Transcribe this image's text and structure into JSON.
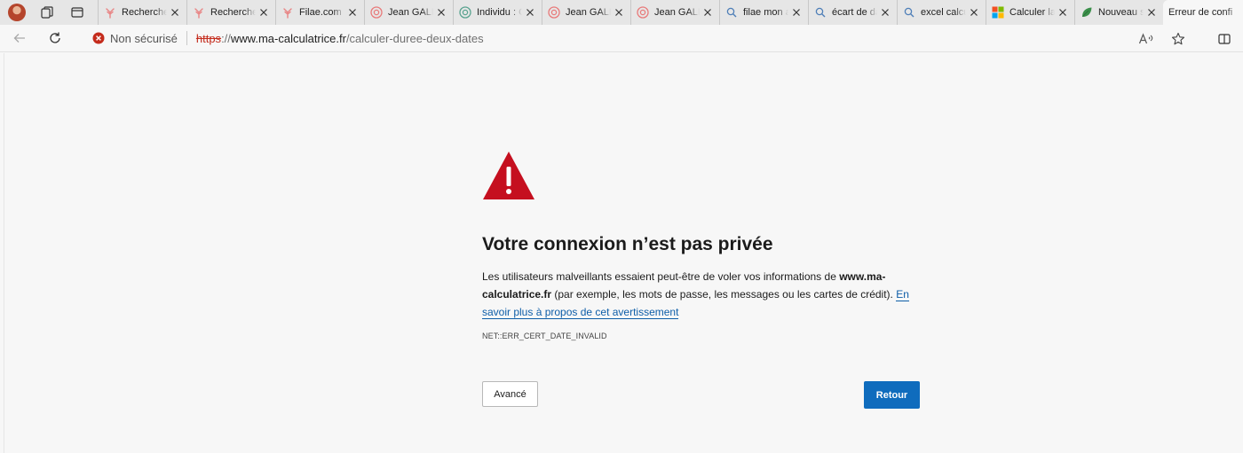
{
  "tabs": [
    {
      "title": "Recherche",
      "icon": "filae-tree-icon"
    },
    {
      "title": "Recherche",
      "icon": "filae-tree-icon"
    },
    {
      "title": "Filae.com -",
      "icon": "filae-tree-icon"
    },
    {
      "title": "Jean GALLE",
      "icon": "geneanet-icon"
    },
    {
      "title": "Individu : G",
      "icon": "geneanet-green-icon"
    },
    {
      "title": "Jean GALLE",
      "icon": "geneanet-icon"
    },
    {
      "title": "Jean GALLE",
      "icon": "geneanet-icon"
    },
    {
      "title": "filae mon a",
      "icon": "search-icon"
    },
    {
      "title": "écart de da",
      "icon": "search-icon"
    },
    {
      "title": "excel calcul",
      "icon": "search-icon"
    },
    {
      "title": "Calculer la",
      "icon": "microsoft-icon"
    },
    {
      "title": "Nouveau su",
      "icon": "leaf-icon"
    }
  ],
  "active_tab": {
    "title": "Erreur de confi"
  },
  "address_bar": {
    "security_label": "Non sécurisé",
    "url_scheme": "https",
    "url_sep": "://",
    "url_host": "www.ma-calculatrice.fr",
    "url_path": "/calculer-duree-deux-dates"
  },
  "page": {
    "heading": "Votre connexion n’est pas privée",
    "desc_part1": "Les utilisateurs malveillants essaient peut-être de voler vos informations de ",
    "desc_host": "www.ma-calculatrice.fr",
    "desc_part2": " (par exemple, les mots de passe, les messages ou les cartes de crédit). ",
    "learn_more": "En savoir plus à propos de cet avertissement",
    "error_code": "NET::ERR_CERT_DATE_INVALID",
    "advanced_button": "Avancé",
    "back_button": "Retour"
  },
  "colors": {
    "warning_red": "#c50f1f",
    "primary_blue": "#0f6cbd",
    "link_blue": "#0e5ea8",
    "insecure_red": "#c42b1c"
  }
}
